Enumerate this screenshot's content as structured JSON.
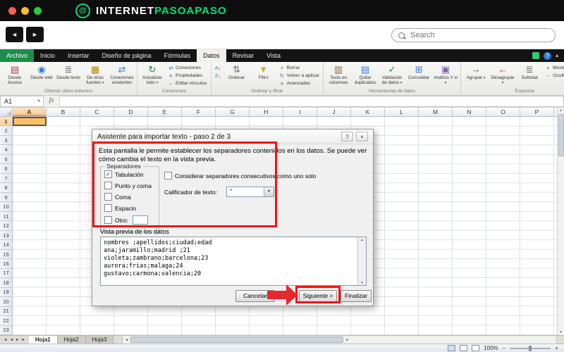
{
  "branding": {
    "white": "INTERNET",
    "green": "PASOAPASO",
    "icon_char": "@"
  },
  "browser": {
    "search_placeholder": "Search"
  },
  "icons": {
    "left": "◄",
    "right": "►",
    "up": "▲",
    "down": "▼",
    "caret": "▾",
    "check": "✓",
    "help": "?",
    "close": "×",
    "minus": "−",
    "plus": "+",
    "minimize": "▴"
  },
  "ribbon": {
    "tabs": [
      {
        "label": "Archivo",
        "style": "archivo"
      },
      {
        "label": "Inicio"
      },
      {
        "label": "Insertar"
      },
      {
        "label": "Diseño de página"
      },
      {
        "label": "Fórmulas"
      },
      {
        "label": "Datos",
        "style": "active"
      },
      {
        "label": "Revisar"
      },
      {
        "label": "Vista"
      }
    ],
    "groups": [
      {
        "label": "Obtener datos externos",
        "name": "obtener-datos-externos",
        "items": [
          {
            "type": "large",
            "name": "desde-access-button",
            "label": "Desde Access",
            "icon": "▤",
            "color": "#a63d57"
          },
          {
            "type": "large",
            "name": "desde-web-button",
            "label": "Desde web",
            "icon": "◉",
            "color": "#2e7dd1"
          },
          {
            "type": "large",
            "name": "desde-texto-button",
            "label": "Desde texto",
            "icon": "≣",
            "color": "#5f6f7f"
          },
          {
            "type": "large",
            "name": "de-otras-fuentes-button",
            "label": "De otras fuentes",
            "icon": "▦",
            "color": "#b8860b",
            "arrow": true
          },
          {
            "type": "large",
            "name": "conexiones-existentes-button",
            "label": "Conexiones existentes",
            "icon": "⇄",
            "color": "#2e7dd1"
          }
        ]
      },
      {
        "label": "Conexiones",
        "name": "conexiones",
        "items": [
          {
            "type": "large",
            "name": "actualizar-todo-button",
            "label": "Actualizar todo",
            "icon": "↻",
            "color": "#1e7d46",
            "arrow": true
          },
          {
            "type": "stack",
            "buttons": [
              {
                "name": "conexiones-button",
                "label": "Conexiones",
                "icon": "⇄",
                "color": "#2e7dd1"
              },
              {
                "name": "propiedades-button",
                "label": "Propiedades",
                "icon": "≡",
                "color": "#5f6f7f"
              },
              {
                "name": "editar-vinculos-button",
                "label": "Editar vínculos",
                "icon": "⇔",
                "color": "#5f6f7f"
              }
            ]
          }
        ]
      },
      {
        "label": "Ordenar y filtrar",
        "name": "ordenar-y-filtrar",
        "items": [
          {
            "type": "stack",
            "buttons": [
              {
                "name": "sort-az-button",
                "label": "",
                "icon": "A↓",
                "color": "#2e7dd1"
              },
              {
                "name": "sort-za-button",
                "label": "",
                "icon": "Z↓",
                "color": "#2e7dd1"
              }
            ]
          },
          {
            "type": "large",
            "name": "ordenar-button",
            "label": "Ordenar",
            "icon": "⇅",
            "color": "#5f6f7f"
          },
          {
            "type": "large",
            "name": "filtro-button",
            "label": "Filtro",
            "icon": "▼",
            "color": "#c8a83c"
          },
          {
            "type": "stack",
            "buttons": [
              {
                "name": "borrar-button",
                "label": "Borrar",
                "icon": "×",
                "color": "#c0392b"
              },
              {
                "name": "volver-a-aplicar-button",
                "label": "Volver a aplicar",
                "icon": "↻",
                "color": "#2e7dd1"
              },
              {
                "name": "avanzadas-button",
                "label": "Avanzadas",
                "icon": "≡",
                "color": "#5f6f7f"
              }
            ]
          }
        ]
      },
      {
        "label": "Herramientas de datos",
        "name": "herramientas-de-datos",
        "items": [
          {
            "type": "large",
            "name": "texto-en-columnas-button",
            "label": "Texto en columnas",
            "icon": "▥",
            "color": "#8a6d3b"
          },
          {
            "type": "large",
            "name": "quitar-duplicados-button",
            "label": "Quitar duplicados",
            "icon": "▤",
            "color": "#2e7dd1"
          },
          {
            "type": "large",
            "name": "validacion-de-datos-button",
            "label": "Validación de datos",
            "icon": "✓",
            "color": "#1e7d46",
            "arrow": true
          },
          {
            "type": "large",
            "name": "consolidar-button",
            "label": "Consolidar",
            "icon": "⊞",
            "color": "#2e7dd1"
          },
          {
            "type": "large",
            "name": "analisis-y-si-button",
            "label": "Análisis Y si",
            "icon": "▣",
            "color": "#8064a2",
            "arrow": true
          }
        ]
      },
      {
        "label": "Esquema",
        "name": "esquema",
        "items": [
          {
            "type": "large",
            "name": "agrupar-button",
            "label": "Agrupar",
            "icon": "→",
            "color": "#1e7d46",
            "arrow": true
          },
          {
            "type": "large",
            "name": "desagrupar-button",
            "label": "Desagrupar",
            "icon": "←",
            "color": "#c0392b",
            "arrow": true
          },
          {
            "type": "large",
            "name": "subtotal-button",
            "label": "Subtotal",
            "icon": "≣",
            "color": "#5f6f7f"
          },
          {
            "type": "stack",
            "buttons": [
              {
                "name": "mostrar-detalle-button",
                "label": "Mostrar detalle",
                "icon": "+",
                "color": "#1e7d46"
              },
              {
                "name": "ocultar-detalle-button",
                "label": "Ocultar detalle",
                "icon": "−",
                "color": "#c0392b"
              }
            ]
          }
        ]
      }
    ]
  },
  "formula_bar": {
    "name_box": "A1",
    "fx_label": "fx"
  },
  "grid": {
    "columns": [
      "A",
      "B",
      "C",
      "D",
      "E",
      "F",
      "G",
      "H",
      "I",
      "J",
      "K",
      "L",
      "M",
      "N",
      "O",
      "P"
    ],
    "rows": [
      "1",
      "2",
      "3",
      "4",
      "5",
      "6",
      "7",
      "8",
      "9",
      "10",
      "11",
      "12",
      "13",
      "14",
      "15",
      "16",
      "17",
      "18",
      "19",
      "20",
      "21",
      "22",
      "23"
    ],
    "selected_cell": "A1"
  },
  "dialog": {
    "title": "Asistente para importar texto - paso 2 de 3",
    "description": "Esta pantalla le permite establecer los separadores contenidos en los datos. Se puede ver cómo cambia el texto en la vista previa.",
    "separators": {
      "label": "Separadores",
      "options": [
        {
          "label": "Tabulación",
          "checked": true
        },
        {
          "label": "Punto y coma",
          "checked": false
        },
        {
          "label": "Coma",
          "checked": false
        },
        {
          "label": "Espacio",
          "checked": false
        },
        {
          "label": "Otro:",
          "checked": false,
          "has_input": true
        }
      ]
    },
    "consecutive_label": "Considerar separadores consecutivos como uno solo",
    "qualifier_label": "Calificador de texto:",
    "qualifier_value": "\"",
    "preview_label": "Vista previa de los datos",
    "preview_lines": [
      "nombres ;apellidos;ciudad;edad",
      "ana;jaramillo;madrid ;21",
      "violeta;zambrano;barcelona;23",
      "aurora;frias;malaga;24",
      "gustavo;carmona;valencia;20"
    ],
    "buttons": {
      "cancel": "Cancelar",
      "next": "Siguiente >",
      "finish": "Finalizar"
    }
  },
  "sheet_tabs": [
    {
      "label": "Hoja1",
      "active": true
    },
    {
      "label": "Hoja2",
      "active": false
    },
    {
      "label": "Hoja3",
      "active": false
    }
  ],
  "status_bar": {
    "zoom": "100%"
  }
}
